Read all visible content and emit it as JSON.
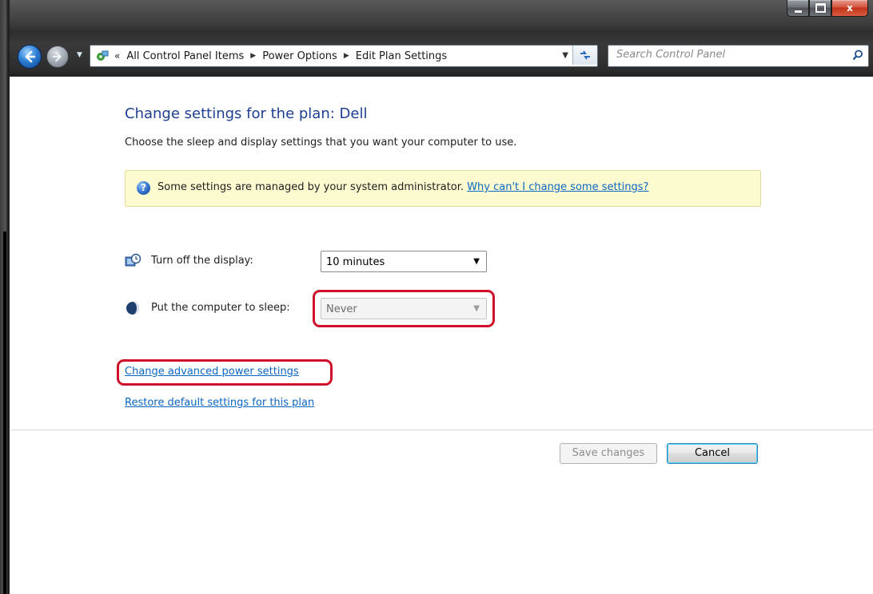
{
  "window": {
    "caption_buttons": {
      "minimize_icon": "minimize-icon",
      "maximize_icon": "maximize-icon",
      "close_label": "x"
    }
  },
  "toolbar": {
    "address": {
      "overflow_chevron": "«",
      "crumbs": [
        "All Control Panel Items",
        "Power Options",
        "Edit Plan Settings"
      ],
      "separator": "▶"
    },
    "search": {
      "placeholder": "Search Control Panel"
    }
  },
  "main": {
    "title": "Change settings for the plan: Dell",
    "subtitle": "Choose the sleep and display settings that you want your computer to use.",
    "info_banner": {
      "icon": "?",
      "text": "Some settings are managed by your system administrator. ",
      "link": "Why can't I change some settings?"
    },
    "settings": [
      {
        "label": "Turn off the display:",
        "value": "10 minutes",
        "enabled": true
      },
      {
        "label": "Put the computer to sleep:",
        "value": "Never",
        "enabled": false
      }
    ],
    "links": {
      "advanced": "Change advanced power settings",
      "restore": "Restore default settings for this plan"
    },
    "buttons": {
      "save": "Save changes",
      "cancel": "Cancel"
    }
  },
  "colors": {
    "title_blue": "#1e3f91",
    "link_blue": "#0b66c3",
    "highlight_red": "#d0102a",
    "banner_bg": "#fdfbd0"
  }
}
